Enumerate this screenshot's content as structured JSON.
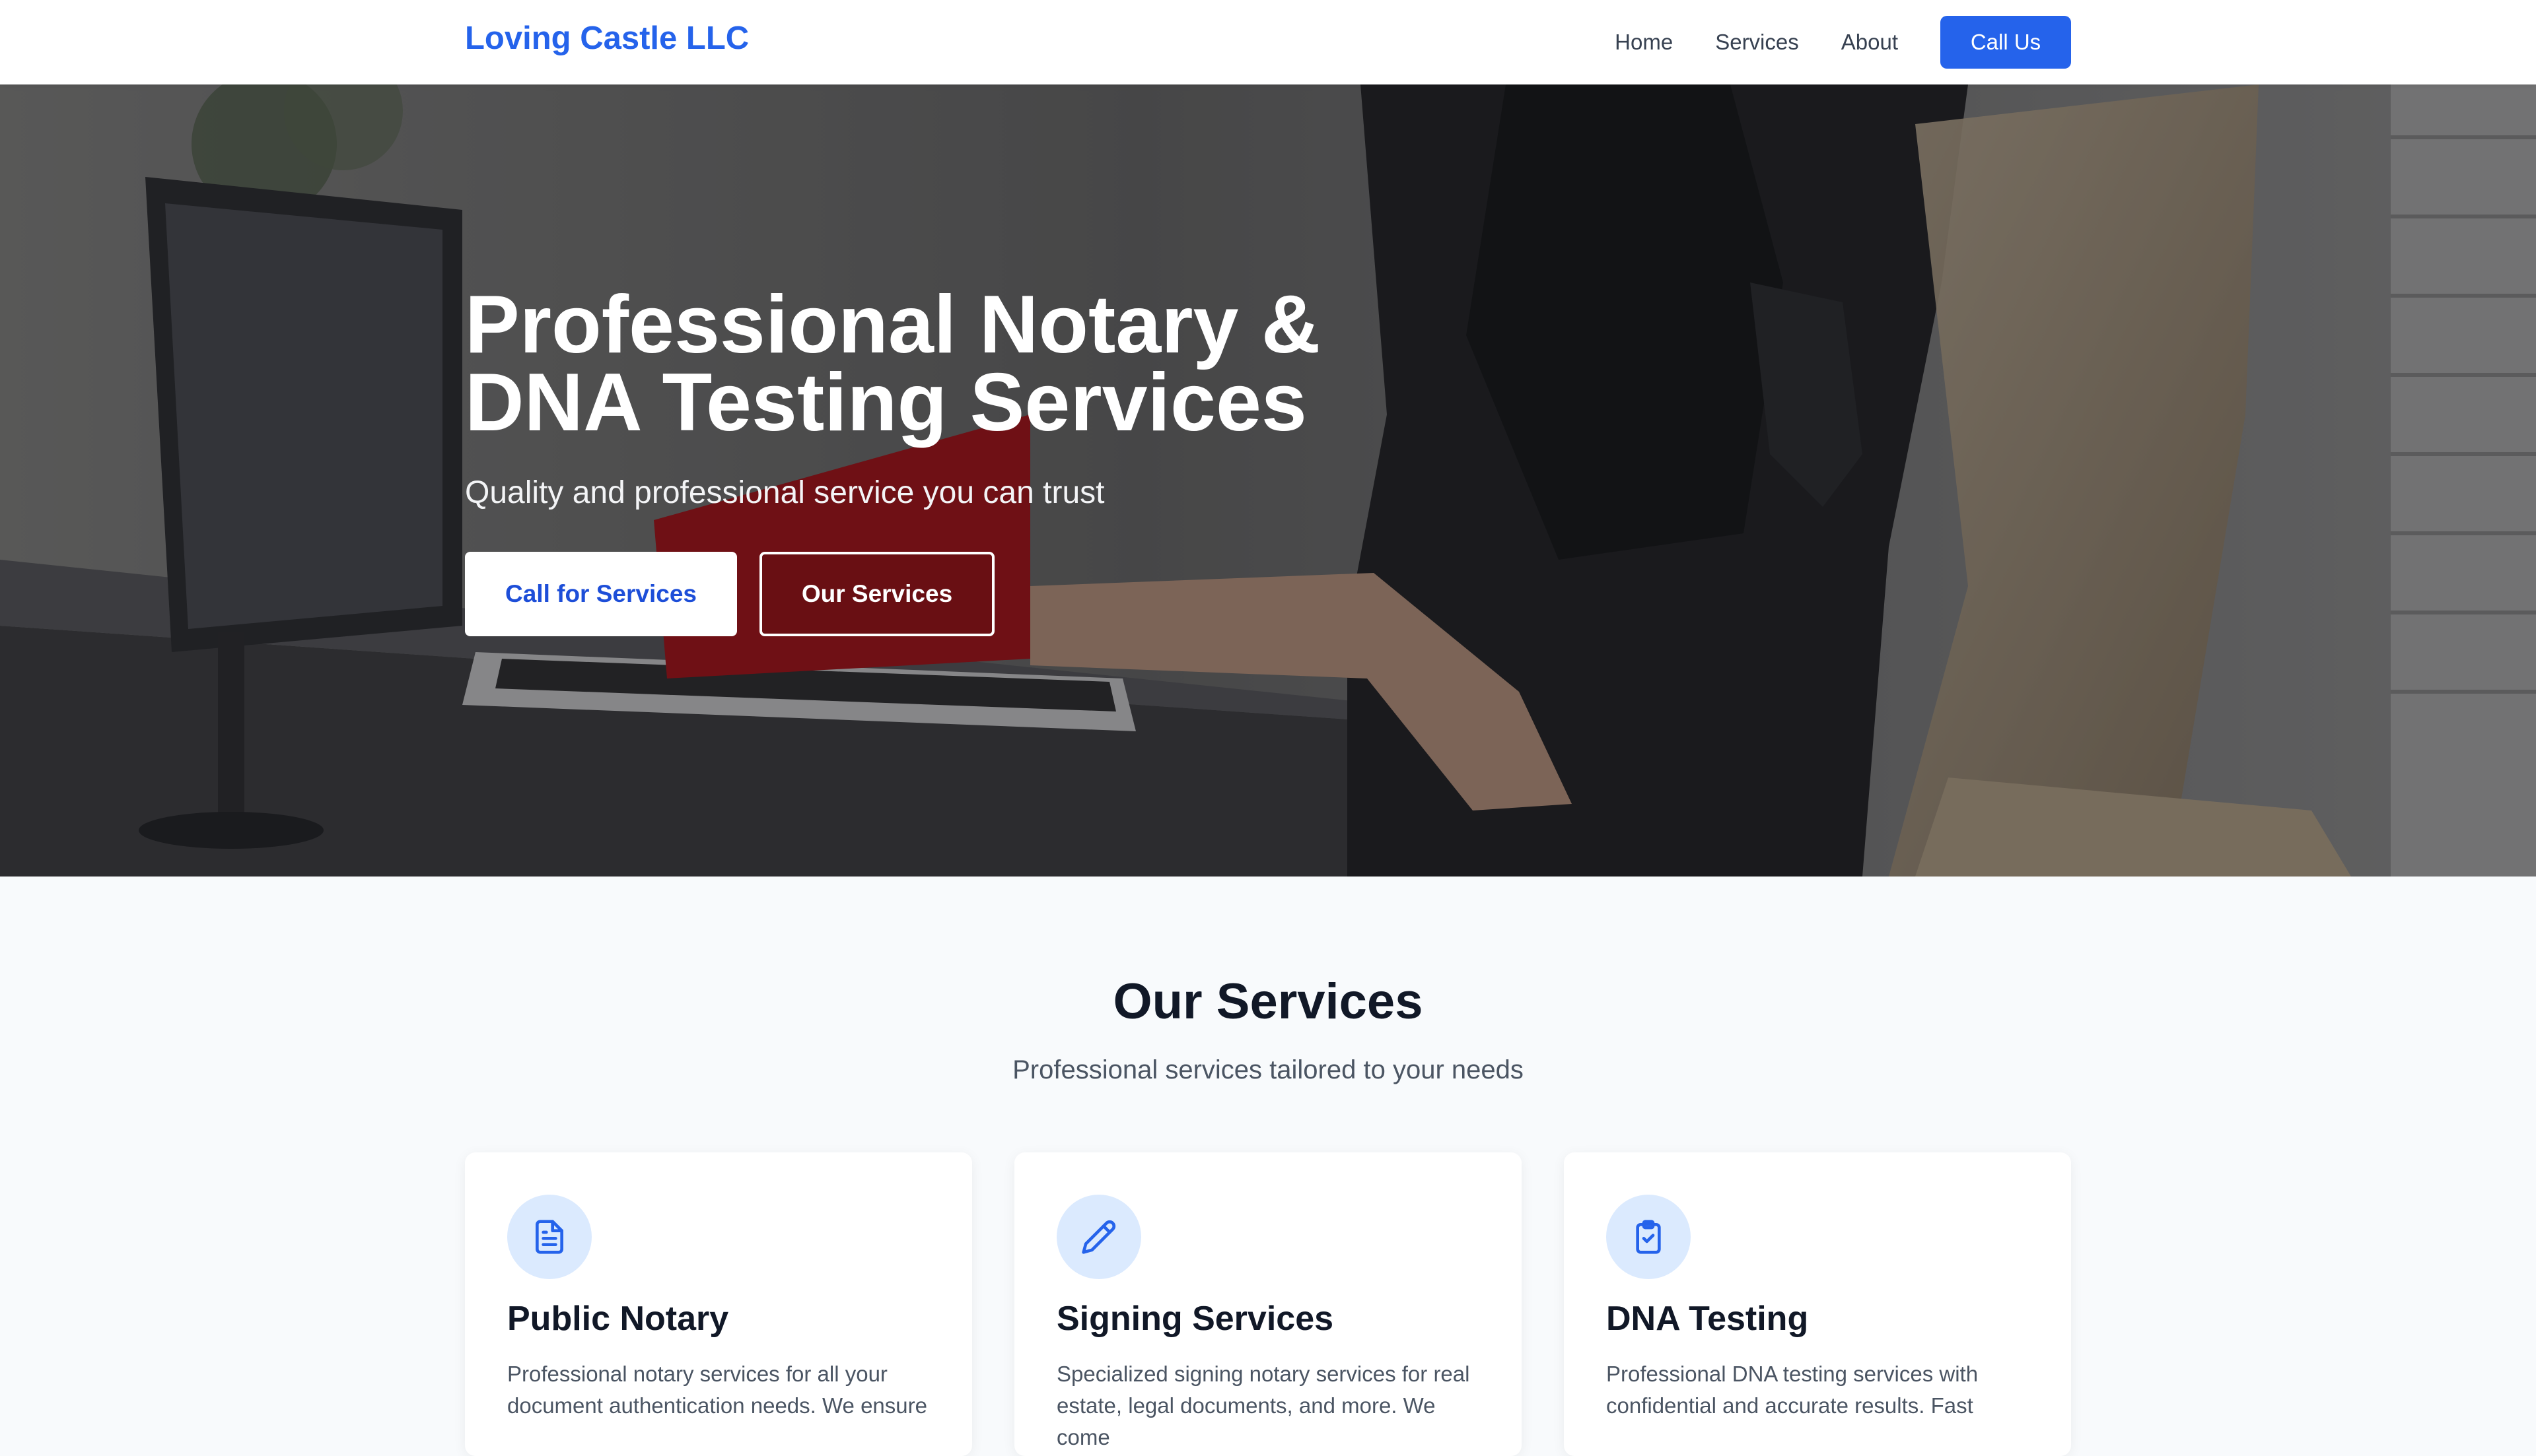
{
  "nav": {
    "brand": "Loving Castle LLC",
    "links": [
      "Home",
      "Services",
      "About"
    ],
    "cta": "Call Us"
  },
  "hero": {
    "title_line1": "Professional Notary &",
    "title_line2": "DNA Testing Services",
    "subtitle": "Quality and professional service you can trust",
    "primary_button": "Call for Services",
    "secondary_button": "Our Services"
  },
  "services": {
    "title": "Our Services",
    "subtitle": "Professional services tailored to your needs",
    "cards": [
      {
        "icon": "document-icon",
        "title": "Public Notary",
        "text_line1": "Professional notary services for all your",
        "text_line2": "document authentication needs. We ensure"
      },
      {
        "icon": "pencil-icon",
        "title": "Signing Services",
        "text_line1": "Specialized signing notary services for real",
        "text_line2": "estate, legal documents, and more. We come"
      },
      {
        "icon": "clipboard-check-icon",
        "title": "DNA Testing",
        "text_line1": "Professional DNA testing services with",
        "text_line2": "confidential and accurate results. Fast"
      }
    ]
  },
  "colors": {
    "brand": "#2563eb",
    "icon_bg": "#dbeafe",
    "page_bg": "#f8fafc"
  }
}
